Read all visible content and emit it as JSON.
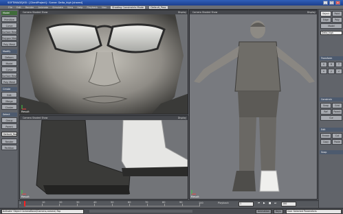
{
  "window": {
    "title": "SOFTIMAGE|XSI : [ClientProject] : Scene: Delta_high [shared]",
    "buttons": [
      "_",
      "□",
      "×"
    ]
  },
  "menubar": {
    "items": [
      "File",
      "Edit",
      "Render",
      "Animate",
      "Simulate",
      "View",
      "Help",
      "Playback",
      "Nav",
      "Shading Constraints Mode",
      "Default_Pass"
    ]
  },
  "left_panel": {
    "model_top": "Model",
    "items_top": [
      "Primitive",
      "Curve",
      "Surface Mesh",
      "Polygon Mesh",
      "Poly. Mesh"
    ],
    "section_modify": "Modify",
    "items_modify": [
      "Deform",
      "Model",
      "Curve",
      "Surface Mesh",
      "Poly. Mesh"
    ],
    "section_create": "Create",
    "items_create": [
      "Edit",
      "Merge",
      "Cluster"
    ],
    "section_select": "Select",
    "items_select": [
      "Group",
      "Parent"
    ],
    "select_field": "Default_Pass",
    "items_bottom": [
      "Render",
      "Partition"
    ]
  },
  "viewports": {
    "top_left": {
      "header": "Camera  Shaded  Show",
      "menu": "Display",
      "result": "Result"
    },
    "top_right": {
      "header": "Camera  Shaded  Show",
      "menu": "Display",
      "result": "Result",
      "stats": {
        "head_selected": "Selected",
        "head_total": "Total",
        "objects_label": "Objects",
        "objects_selected": "1",
        "objects_total": "773",
        "triangles_label": "Triangles",
        "triangles_selected": "11133184",
        "triangles_total": "14473782"
      }
    },
    "bottom_left": {
      "header": "Camera  Shaded  Show",
      "menu": "Display",
      "result": "Result"
    },
    "bottom_right": {
      "header": "Camera  Shaded  Show",
      "menu": "Display",
      "result": "Result"
    }
  },
  "right_panel": {
    "top_buttons": [
      "Object",
      "Point",
      "Edge",
      "Poly",
      "Model"
    ],
    "name_field": "Delta_high",
    "section_transform": "Transform",
    "transform_buttons": [
      "S",
      "R",
      "T"
    ],
    "axis_labels": [
      "x",
      "y",
      "z"
    ],
    "section_constrain": "Constrain",
    "constrain_buttons": [
      "Snap",
      "Grid",
      "Ref",
      "Parent",
      "Cur"
    ],
    "section_edit": "Edit",
    "edit_buttons": [
      "Freeze",
      "Cut",
      "Copy",
      "Paste"
    ],
    "section_snap": "Snap"
  },
  "timeline": {
    "start": "1",
    "end": "100",
    "current": "1",
    "ticks": [
      "10",
      "20",
      "30",
      "40",
      "50",
      "60",
      "70",
      "80",
      "90"
    ]
  },
  "statusbar": {
    "command": "Activate 'Object CameraBand(Camera,camera) Top",
    "playback_label": "Playback",
    "frame_field": "1",
    "end_field": "100",
    "animation_label": "Animation",
    "keys_label": "Keys",
    "user_keys": "User Selected Parameters"
  },
  "colors": {
    "accent": "#2f5fb8",
    "viewport_bg": "#777a7f",
    "panel": "#61646a",
    "timeline_cursor": "#ff2020"
  }
}
